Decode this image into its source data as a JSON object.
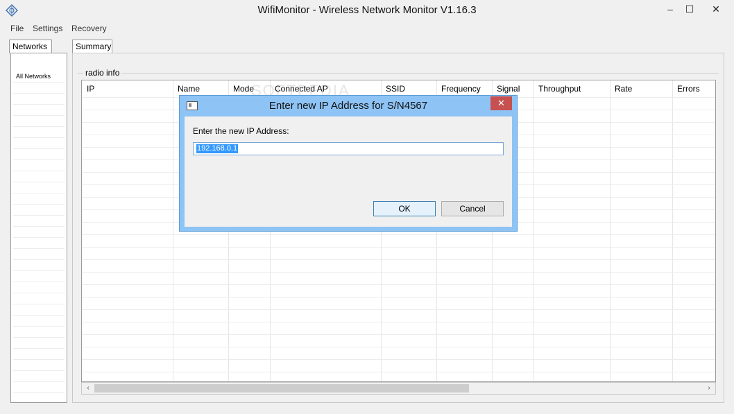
{
  "window": {
    "title": "WifiMonitor - Wireless Network Monitor V1.16.3",
    "minimize_glyph": "‒",
    "maximize_glyph": "☐",
    "close_glyph": "✕"
  },
  "menu": [
    "File",
    "Settings",
    "Recovery"
  ],
  "left_tabs": {
    "active": "Networks"
  },
  "main_tabs": {
    "active": "Summary"
  },
  "networks_list": [
    "All Networks"
  ],
  "group": {
    "label": "radio info"
  },
  "table": {
    "columns": [
      "IP",
      "Name",
      "Mode",
      "Connected AP",
      "SSID",
      "Frequency",
      "Signal",
      "Throughput",
      "Rate",
      "Errors"
    ]
  },
  "watermark": "SOFTPEDIA",
  "dialog": {
    "title": "Enter new IP Address for S/N4567",
    "close_glyph": "✕",
    "prompt": "Enter the new IP Address:",
    "ip_value": "192.168.0.1",
    "ok_label": "OK",
    "cancel_label": "Cancel"
  },
  "scroll": {
    "left_glyph": "‹",
    "right_glyph": "›"
  },
  "colors": {
    "dialog_frame": "#8ec3f5",
    "close_button": "#c75050",
    "selection": "#3399ff"
  }
}
